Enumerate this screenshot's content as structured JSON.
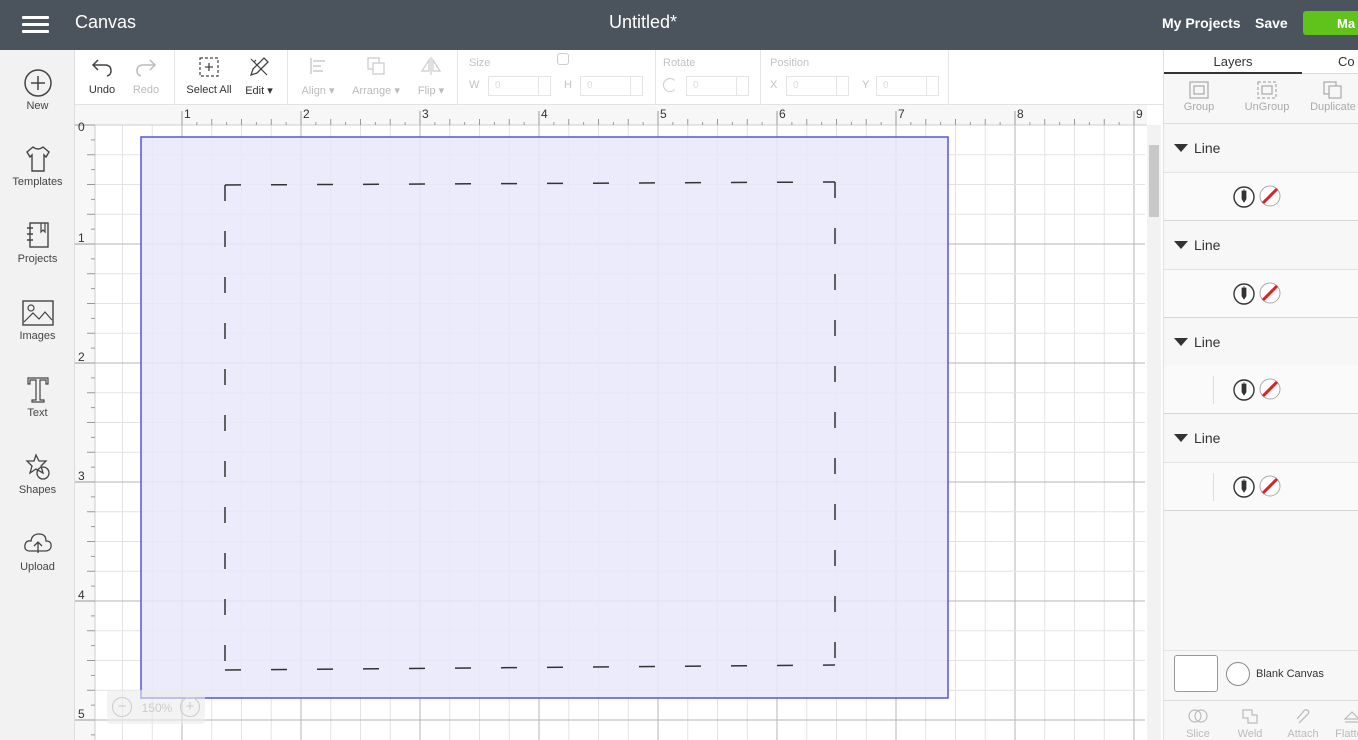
{
  "header": {
    "app_title": "Canvas",
    "doc_title": "Untitled*",
    "my_projects": "My Projects",
    "save": "Save",
    "make": "Make It",
    "make_visible": "Ma",
    "accent_color": "#5fc31b",
    "bg_color": "#4b545c"
  },
  "sidebar": {
    "items": [
      {
        "label": "New",
        "icon": "plus-circle-icon"
      },
      {
        "label": "Templates",
        "icon": "tshirt-icon"
      },
      {
        "label": "Projects",
        "icon": "notebook-icon"
      },
      {
        "label": "Images",
        "icon": "image-icon"
      },
      {
        "label": "Text",
        "icon": "text-t-icon"
      },
      {
        "label": "Shapes",
        "icon": "shapes-icon"
      },
      {
        "label": "Upload",
        "icon": "cloud-upload-icon"
      }
    ]
  },
  "toolbar": {
    "undo": "Undo",
    "redo": "Redo",
    "select_all": "Select All",
    "edit": "Edit",
    "align": "Align",
    "arrange": "Arrange",
    "flip": "Flip",
    "size_label": "Size",
    "w_label": "W",
    "h_label": "H",
    "w_value": "0",
    "h_value": "0",
    "rotate_label": "Rotate",
    "rotate_value": "0",
    "position_label": "Position",
    "x_label": "X",
    "y_label": "Y",
    "x_value": "0",
    "y_value": "0"
  },
  "canvas": {
    "ruler_h": [
      "1",
      "2",
      "3",
      "4",
      "5",
      "6",
      "7",
      "8",
      "9"
    ],
    "ruler_v": [
      "0",
      "1",
      "2",
      "3",
      "4",
      "5"
    ],
    "zoom_level": "150%",
    "zoom_minus": "−",
    "zoom_plus": "+",
    "mat_fill": "#e8e8fc",
    "mat_stroke": "#5555dd"
  },
  "right_panel": {
    "tabs": [
      "Layers",
      "Color Sync"
    ],
    "tab_color_visible": "Co",
    "tools": [
      "Group",
      "UnGroup",
      "Duplicate"
    ],
    "layers": [
      {
        "name": "Line"
      },
      {
        "name": "Line"
      },
      {
        "name": "Line"
      },
      {
        "name": "Line"
      }
    ],
    "blank_canvas": "Blank Canvas",
    "bottom_tools": [
      "Slice",
      "Weld",
      "Attach",
      "Flatten"
    ]
  }
}
